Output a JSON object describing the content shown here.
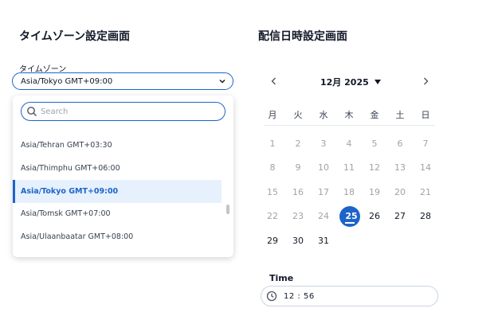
{
  "timezone_section": {
    "title": "タイムゾーン設定画面",
    "label": "タイムゾーン",
    "selected": "Asia/Tokyo GMT+09:00",
    "search_placeholder": "Search",
    "options": [
      {
        "label": "Asia/Tehran GMT+03:30",
        "selected": false
      },
      {
        "label": "Asia/Thimphu GMT+06:00",
        "selected": false
      },
      {
        "label": "Asia/Tokyo GMT+09:00",
        "selected": true
      },
      {
        "label": "Asia/Tomsk GMT+07:00",
        "selected": false
      },
      {
        "label": "Asia/Ulaanbaatar GMT+08:00",
        "selected": false
      }
    ]
  },
  "datetime_section": {
    "title": "配信日時設定画面",
    "month_label": "12月 2025",
    "weekdays": [
      "月",
      "火",
      "水",
      "木",
      "金",
      "土",
      "日"
    ],
    "days": [
      [
        "1",
        "2",
        "3",
        "4",
        "5",
        "6",
        "7"
      ],
      [
        "8",
        "9",
        "10",
        "11",
        "12",
        "13",
        "14"
      ],
      [
        "15",
        "16",
        "17",
        "18",
        "19",
        "20",
        "21"
      ],
      [
        "22",
        "23",
        "24",
        "25",
        "26",
        "27",
        "28"
      ],
      [
        "29",
        "30",
        "31",
        "",
        "",
        "",
        ""
      ]
    ],
    "selected_day": "25",
    "time_label": "Time",
    "time_value": "12 : 56"
  },
  "colors": {
    "accent": "#1d64c9",
    "selected_bg": "#e6f1fd"
  }
}
